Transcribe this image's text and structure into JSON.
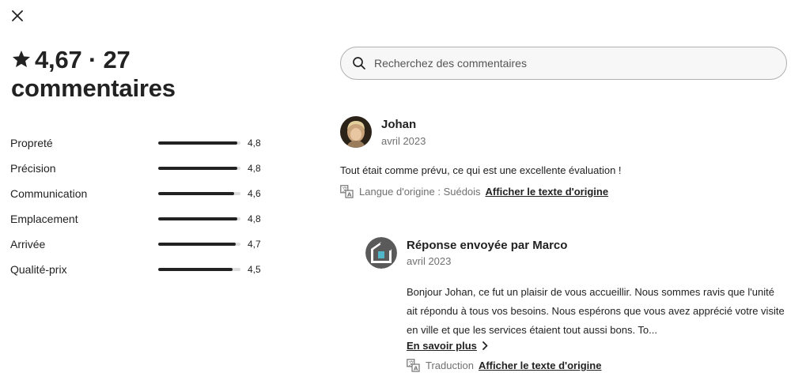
{
  "close": {
    "icon": "close-icon"
  },
  "summary": {
    "icon": "star-icon",
    "text_line1": "4,67 · 27",
    "text_line2": "commentaires"
  },
  "ratings": [
    {
      "label": "Propreté",
      "value": "4,8",
      "fraction": 0.96
    },
    {
      "label": "Précision",
      "value": "4,8",
      "fraction": 0.96
    },
    {
      "label": "Communication",
      "value": "4,6",
      "fraction": 0.92
    },
    {
      "label": "Emplacement",
      "value": "4,8",
      "fraction": 0.96
    },
    {
      "label": "Arrivée",
      "value": "4,7",
      "fraction": 0.94
    },
    {
      "label": "Qualité-prix",
      "value": "4,5",
      "fraction": 0.9
    }
  ],
  "search": {
    "icon": "search-icon",
    "placeholder": "Recherchez des commentaires",
    "value": ""
  },
  "review": {
    "name": "Johan",
    "date": "avril 2023",
    "text": "Tout était comme prévu, ce qui est une excellente évaluation !",
    "lang_icon": "translate-icon",
    "lang_label": "Langue d'origine : Suédois",
    "lang_link": "Afficher le texte d'origine"
  },
  "response": {
    "title": "Réponse envoyée par Marco",
    "date": "avril 2023",
    "text": "Bonjour Johan, ce fut un plaisir de vous accueillir. Nous sommes ravis que l'unité ait répondu à tous vos besoins. Nous espérons que vous avez apprécié votre visite en ville et que les services étaient tout aussi bons. To...",
    "more_label": "En savoir plus",
    "more_icon": "chevron-right-icon",
    "lang_icon": "translate-icon",
    "lang_label": "Traduction",
    "lang_link": "Afficher le texte d'origine"
  }
}
